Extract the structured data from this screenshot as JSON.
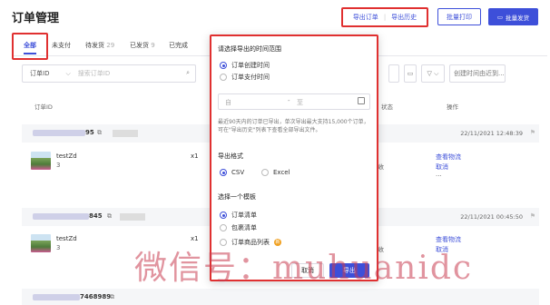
{
  "page": {
    "title": "订单管理"
  },
  "header": {
    "export_order": "导出订单",
    "export_separator": "|",
    "export_history": "导出历史",
    "batch_print": "批量打印",
    "batch_ship": "批量发货"
  },
  "tabs": [
    {
      "label": "全部",
      "count": ""
    },
    {
      "label": "未支付",
      "count": ""
    },
    {
      "label": "待发货",
      "count": "29"
    },
    {
      "label": "已发货",
      "count": "9"
    },
    {
      "label": "已完成",
      "count": ""
    }
  ],
  "filter": {
    "id_select": "订单ID",
    "search_placeholder": "搜索订单ID",
    "sort_select": "创建时间由近到..."
  },
  "table": {
    "col_order_id": "订单ID",
    "col_status": "状态",
    "col_action": "操作"
  },
  "orders": [
    {
      "id_suffix": "95",
      "time": "22/11/2021 12:48:39",
      "product": "testZd",
      "qty": "3",
      "x_qty": "x1",
      "status_red": "货",
      "status_gray": "揽收",
      "action1": "查看物流",
      "action2": "取消",
      "more": "..."
    },
    {
      "id_suffix": "845",
      "time": "22/11/2021 00:45:50",
      "product": "testZd",
      "qty": "3",
      "x_qty": "x1",
      "status_red": "货",
      "status_gray": "揽收",
      "action1": "查看物流",
      "action2": "取消",
      "more": ""
    },
    {
      "id_suffix": "7468989",
      "time": "",
      "product": "",
      "qty": "",
      "x_qty": "",
      "status_red": "",
      "status_gray": "",
      "action1": "",
      "action2": "",
      "more": ""
    }
  ],
  "modal": {
    "time_range_title": "请选择导出的时间范围",
    "time_options": [
      "订单创建时间",
      "订单支付时间"
    ],
    "date_from_placeholder": "自",
    "date_dash": "-",
    "date_to_placeholder": "至",
    "note": "最近90天内的订单已导出，单次导出最大支持15,000个订单，可在\"导出历史\"列表下查看全部导出文件。",
    "format_title": "导出格式",
    "formats": [
      "CSV",
      "Excel"
    ],
    "template_title": "选择一个模板",
    "templates": [
      "订单清单",
      "包裹清单",
      "订单商品列表"
    ],
    "hot_badge": "新",
    "cancel": "取消",
    "confirm": "导出"
  },
  "watermark": "微信号：muhuanidc",
  "colors": {
    "accent": "#3d4fd9",
    "highlight_border": "#e03030"
  }
}
